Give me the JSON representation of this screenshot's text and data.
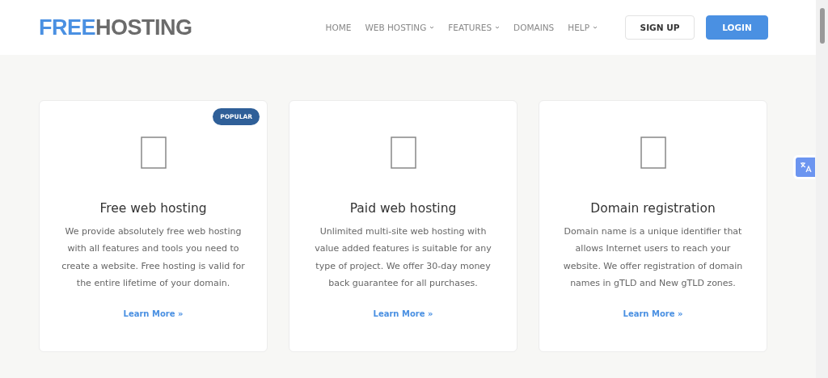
{
  "logo": {
    "first": "FREE",
    "second": "HOSTING"
  },
  "nav": [
    {
      "label": "HOME",
      "dropdown": false
    },
    {
      "label": "WEB HOSTING",
      "dropdown": true
    },
    {
      "label": "FEATURES",
      "dropdown": true
    },
    {
      "label": "DOMAINS",
      "dropdown": false
    },
    {
      "label": "HELP",
      "dropdown": true
    }
  ],
  "buttons": [
    {
      "label": "SIGN UP",
      "kind": "outline"
    },
    {
      "label": "LOGIN",
      "kind": "primary"
    }
  ],
  "cards": [
    {
      "badge": "POPULAR",
      "title": "Free web hosting",
      "text": "We provide absolutely free web hosting with all features and tools you need to create a website. Free hosting is valid for the entire lifetime of your domain.",
      "link": "Learn More »"
    },
    {
      "title": "Paid web hosting",
      "text": "Unlimited multi-site web hosting with value added features is suitable for any type of project. We offer 30-day money back guarantee for all purchases.",
      "link": "Learn More »"
    },
    {
      "title": "Domain registration",
      "text": "Domain name is a unique identifier that allows Internet users to reach your website. We offer registration of domain names in gTLD and New gTLD zones.",
      "link": "Learn More »"
    }
  ]
}
